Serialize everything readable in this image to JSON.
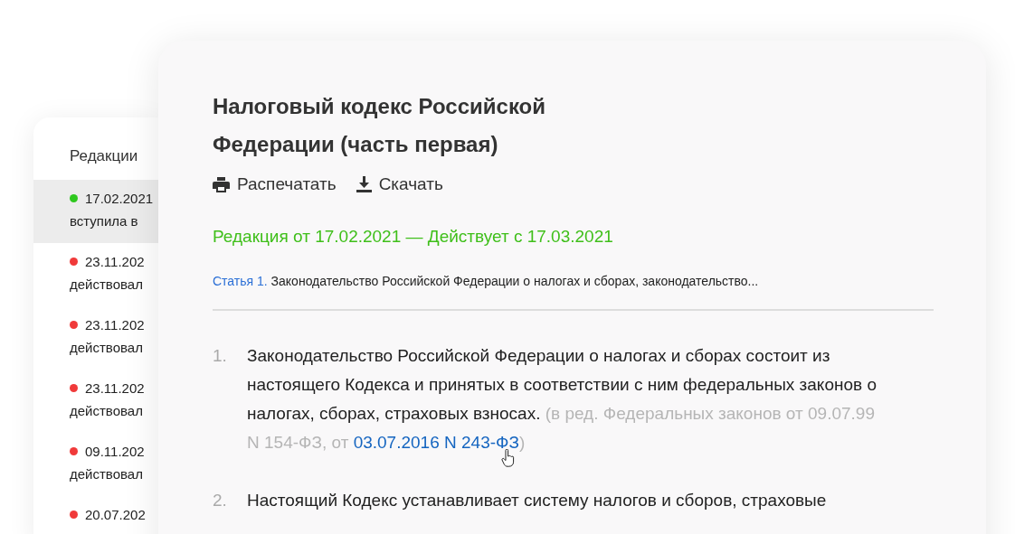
{
  "editions_panel": {
    "title": "Редакции",
    "items": [
      {
        "date": "17.02.2021",
        "status": "вступила в",
        "color": "#2ec81e",
        "selected": true
      },
      {
        "date": "23.11.202",
        "status": "действовал",
        "color": "#f03a3a",
        "selected": false
      },
      {
        "date": "23.11.202",
        "status": "действовал",
        "color": "#f03a3a",
        "selected": false
      },
      {
        "date": "23.11.202",
        "status": "действовал",
        "color": "#f03a3a",
        "selected": false
      },
      {
        "date": "09.11.202",
        "status": "действовал",
        "color": "#f03a3a",
        "selected": false
      },
      {
        "date": "20.07.202",
        "color": "#f03a3a",
        "selected": false
      }
    ]
  },
  "document": {
    "title": "Налоговый кодекс Российской Федерации (часть первая)",
    "actions": [
      {
        "kind": "print",
        "label": "Распечатать"
      },
      {
        "kind": "download",
        "label": "Скачать"
      }
    ],
    "edition_status": "Редакция от 17.02.2021 — Действует с 17.03.2021",
    "article": {
      "number": "Статья 1.",
      "title": "Законодательство Российской Федерации о налогах и сборах, законодательство..."
    },
    "paragraphs": [
      {
        "number": "1.",
        "text": "Законодательство Российской Федерации о налогах и сборах состоит из настоящего Кодекса и принятых в соответствии с ним федеральных законов о налогах, сборах, страховых взносах.",
        "note": "(в ред. Федеральных законов от 09.07.99 N 154-ФЗ, от",
        "link": "03.07.2016 N 243-ФЗ",
        "note_end": ")"
      },
      {
        "number": "2.",
        "text": "Настоящий Кодекс устанавливает систему налогов и сборов, страховые"
      }
    ]
  }
}
